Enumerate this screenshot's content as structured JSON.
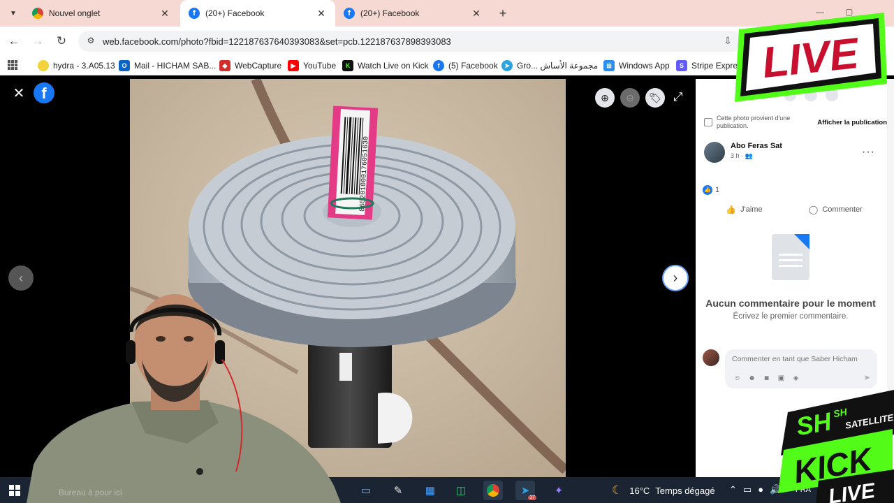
{
  "tabs": [
    {
      "title": "Nouvel onglet",
      "close": "✕"
    },
    {
      "title": "(20+) Facebook",
      "close": "✕"
    },
    {
      "title": "(20+) Facebook",
      "close": "✕"
    }
  ],
  "new_tab": "+",
  "address": {
    "url": "web.facebook.com/photo?fbid=122187637640393083&set=pcb.122187637898393083"
  },
  "bookmarks": [
    {
      "label": "hydra - 3.A05.13"
    },
    {
      "label": "Mail - HICHAM SAB..."
    },
    {
      "label": "WebCapture"
    },
    {
      "label": "YouTube"
    },
    {
      "label": "Watch Live on Kick"
    },
    {
      "label": "(5) Facebook"
    },
    {
      "label": "Gro... مجموعة الأساش"
    },
    {
      "label": "Windows App"
    },
    {
      "label": "Stripe Express"
    }
  ],
  "viewer": {
    "close": "✕",
    "fb_letter": "f",
    "prev": "‹",
    "next": "›",
    "fullscreen": "⤢"
  },
  "panel": {
    "notice_text": "Cette photo provient d'une publication.",
    "notice_link": "Afficher la publication",
    "author_name": "Abo Feras Sat",
    "author_meta": "3 h · 👥",
    "more": "···",
    "like_count": "1",
    "like_label": "J'aime",
    "comment_label": "Commenter",
    "empty_title": "Aucun commentaire pour le moment",
    "empty_sub": "Écrivez le premier commentaire.",
    "comment_placeholder": "Commenter en tant que Saber Hicham"
  },
  "photo": {
    "barcode_text": "865201000176051630"
  },
  "taskbar": {
    "temperature": "16°C",
    "weather": "Temps dégagé",
    "lang": "FRA",
    "clock": "2/",
    "telegram_badge": "37"
  },
  "webcam_label": "Bureau à pour ici",
  "overlays": {
    "live_text": "LIVE",
    "kick_sh": "SH",
    "kick_sh2": "SH",
    "kick_satellite": "SATELLITE",
    "kick_text": "KICK",
    "kick_live": "LIVE"
  },
  "colors": {
    "facebook_blue": "#1877f2",
    "live_red": "#c8102e",
    "kick_green": "#53fc18",
    "tab_strip": "#f6d9d3",
    "taskbar": "#1a2433"
  }
}
